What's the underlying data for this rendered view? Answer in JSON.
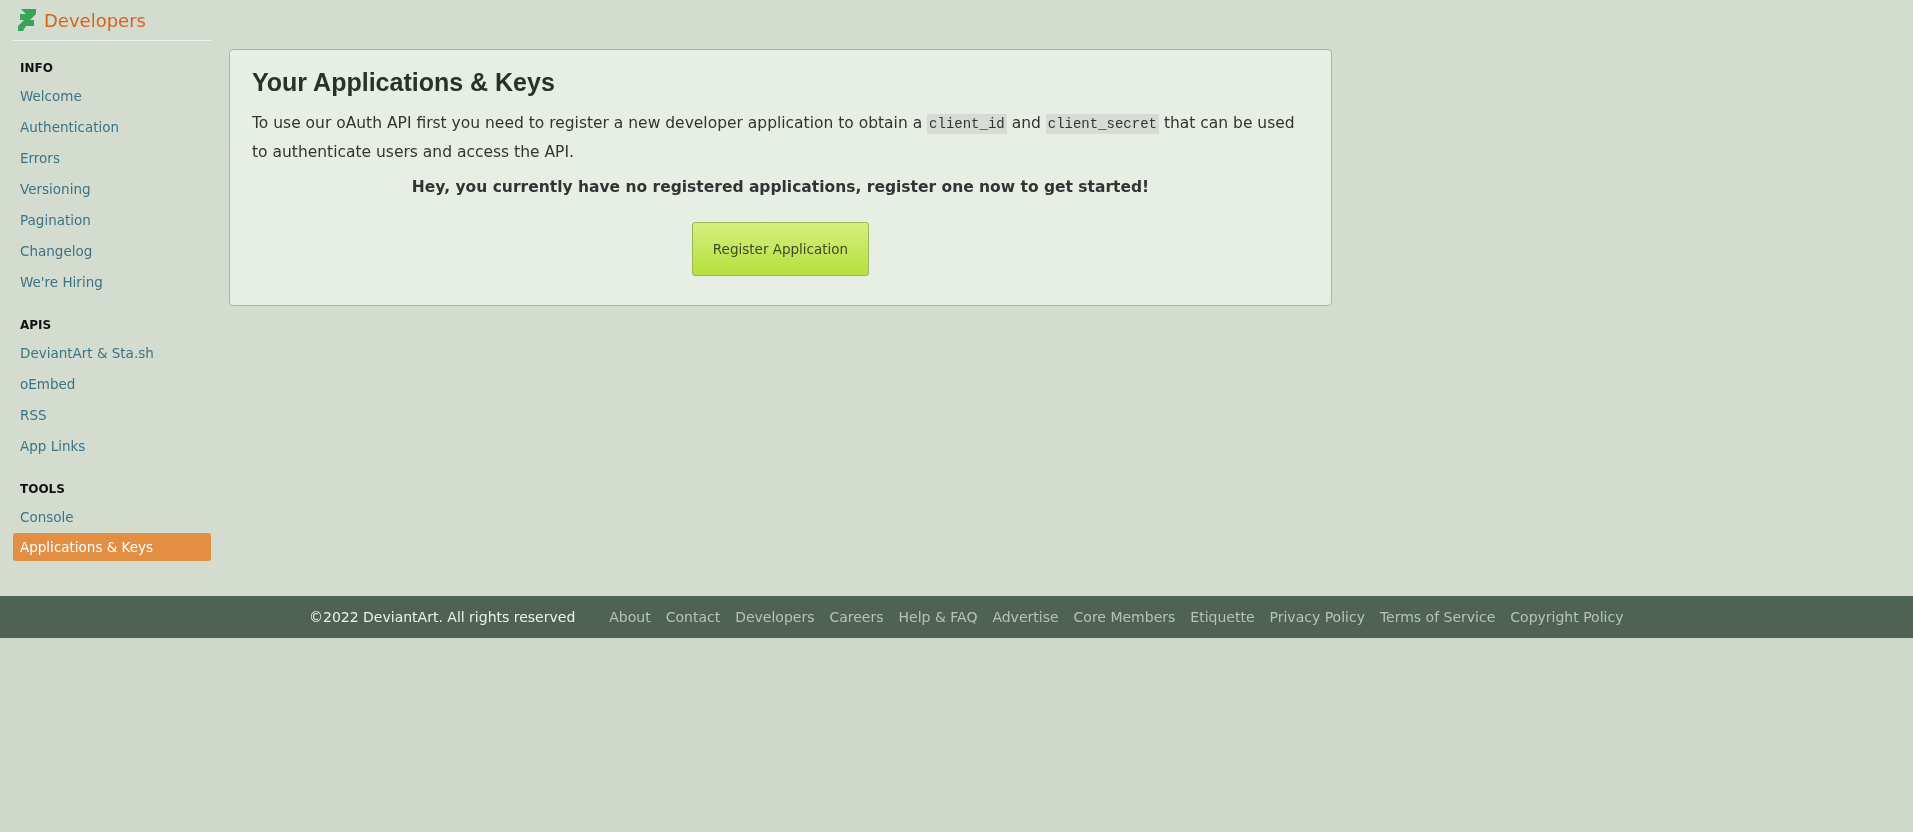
{
  "header": {
    "title": "Developers"
  },
  "sidebar": {
    "sections": [
      {
        "heading": "INFO",
        "items": [
          {
            "label": "Welcome",
            "selected": false
          },
          {
            "label": "Authentication",
            "selected": false
          },
          {
            "label": "Errors",
            "selected": false
          },
          {
            "label": "Versioning",
            "selected": false
          },
          {
            "label": "Pagination",
            "selected": false
          },
          {
            "label": "Changelog",
            "selected": false
          },
          {
            "label": "We're Hiring",
            "selected": false
          }
        ]
      },
      {
        "heading": "APIS",
        "items": [
          {
            "label": "DeviantArt & Sta.sh",
            "selected": false
          },
          {
            "label": "oEmbed",
            "selected": false
          },
          {
            "label": "RSS",
            "selected": false
          },
          {
            "label": "App Links",
            "selected": false
          }
        ]
      },
      {
        "heading": "TOOLS",
        "items": [
          {
            "label": "Console",
            "selected": false
          },
          {
            "label": "Applications & Keys",
            "selected": true
          }
        ]
      }
    ]
  },
  "main": {
    "title": "Your Applications & Keys",
    "intro": [
      {
        "kind": "text",
        "text": "To use our oAuth API first you need to register a new developer application to obtain a "
      },
      {
        "kind": "code",
        "text": "client_id"
      },
      {
        "kind": "text",
        "text": " and "
      },
      {
        "kind": "code",
        "text": "client_secret"
      },
      {
        "kind": "text",
        "text": " that can be used to authenticate users and access the API."
      }
    ],
    "notice": "Hey, you currently have no registered applications, register one now to get started!",
    "button": "Register Application"
  },
  "footer": {
    "copyright": "©2022 DeviantArt. All rights reserved",
    "links": [
      "About",
      "Contact",
      "Developers",
      "Careers",
      "Help & FAQ",
      "Advertise",
      "Core Members",
      "Etiquette",
      "Privacy Policy",
      "Terms of Service",
      "Copyright Policy"
    ]
  }
}
